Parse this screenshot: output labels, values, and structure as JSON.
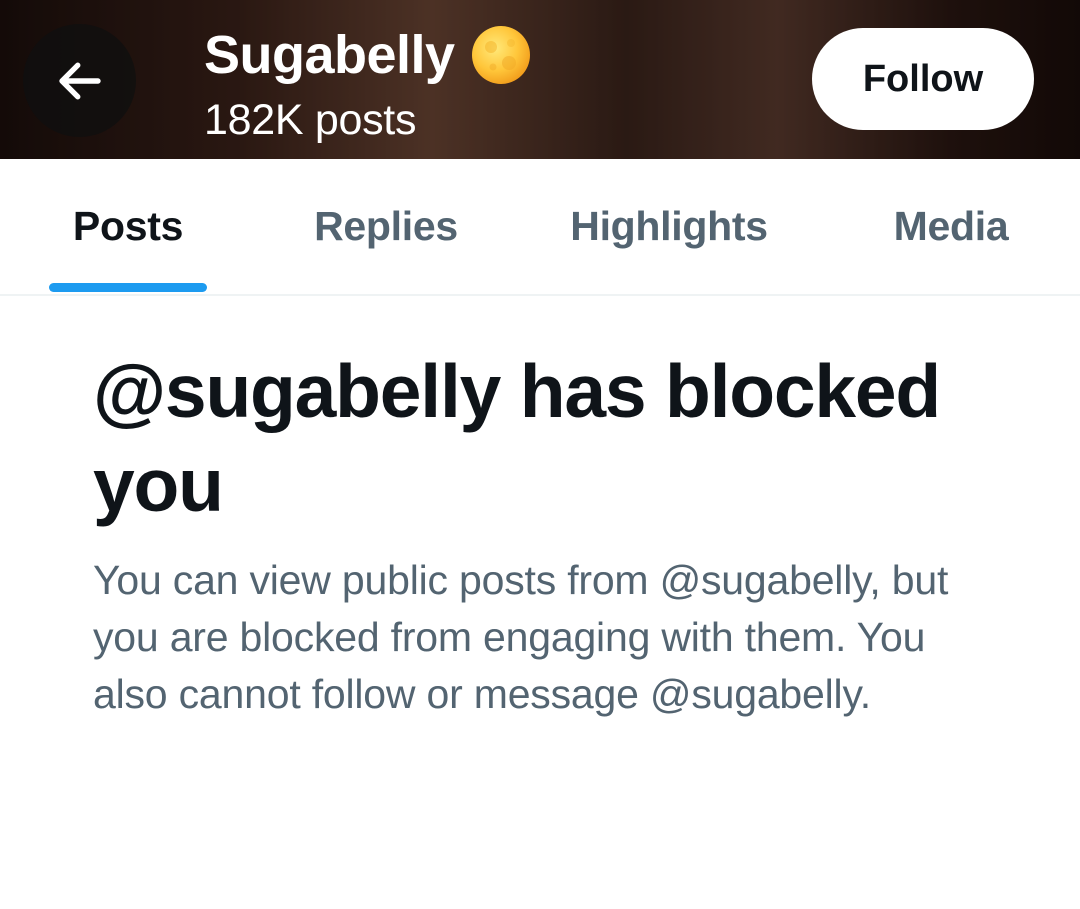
{
  "header": {
    "display_name": "Sugabelly",
    "post_count": "182K posts",
    "follow_label": "Follow",
    "back_icon": "arrow-left-icon",
    "name_emoji_icon": "full-moon-emoji-icon"
  },
  "tabs": [
    {
      "label": "Posts",
      "active": true
    },
    {
      "label": "Replies",
      "active": false
    },
    {
      "label": "Highlights",
      "active": false
    },
    {
      "label": "Media",
      "active": false
    }
  ],
  "blocked": {
    "title": "@sugabelly has blocked you",
    "description": "You can view public posts from @sugabelly, but you are blocked from engaging with them. You also cannot follow or message @sugabelly."
  },
  "colors": {
    "accent": "#1d9bf0",
    "primary_text": "#0f1419",
    "secondary_text": "#536471"
  }
}
